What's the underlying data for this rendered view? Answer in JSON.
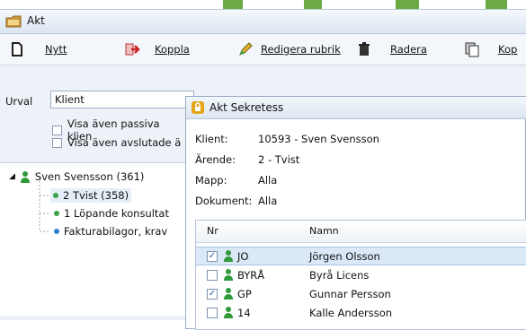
{
  "window": {
    "title": "Akt"
  },
  "toolbar": {
    "items": [
      {
        "label": "Nytt",
        "icon": "new-document-icon"
      },
      {
        "label": "Koppla",
        "icon": "link-arrow-icon"
      },
      {
        "label": "Redigera rubrik",
        "icon": "edit-pencil-icon"
      },
      {
        "label": "Radera",
        "icon": "trash-icon"
      },
      {
        "label": "Kop",
        "icon": "copy-icon"
      }
    ]
  },
  "left": {
    "urval_label": "Urval",
    "urval_value": "Klient",
    "options": [
      "Visa även passiva klien",
      "Visa även avslutade ä"
    ]
  },
  "tree": {
    "nodes": [
      {
        "label": "Sven Svensson (361)"
      },
      {
        "label": "2 Tvist (358)"
      },
      {
        "label": "1 Löpande konsultat"
      },
      {
        "label": "Fakturabilagor, krav"
      }
    ]
  },
  "dialog": {
    "title": "Akt Sekretess",
    "info": [
      {
        "label": "Klient:",
        "value": "10593 - Sven Svensson"
      },
      {
        "label": "Ärende:",
        "value": "2 - Tvist"
      },
      {
        "label": "Mapp:",
        "value": "Alla"
      },
      {
        "label": "Dokument:",
        "value": "Alla"
      }
    ],
    "columns": {
      "nr": "Nr",
      "namn": "Namn"
    },
    "rows": [
      {
        "checked": "✓",
        "code": "JO",
        "name": "Jörgen Olsson"
      },
      {
        "checked": "",
        "code": "BYRÅ",
        "name": "Byrå Licens"
      },
      {
        "checked": "✓",
        "code": "GP",
        "name": "Gunnar Persson"
      },
      {
        "checked": "",
        "code": "14",
        "name": "Kalle Andersson"
      }
    ]
  },
  "colors": {
    "accent": "#2f9a3a",
    "selection": "#dbe8f8",
    "lock": "#e3a514"
  }
}
